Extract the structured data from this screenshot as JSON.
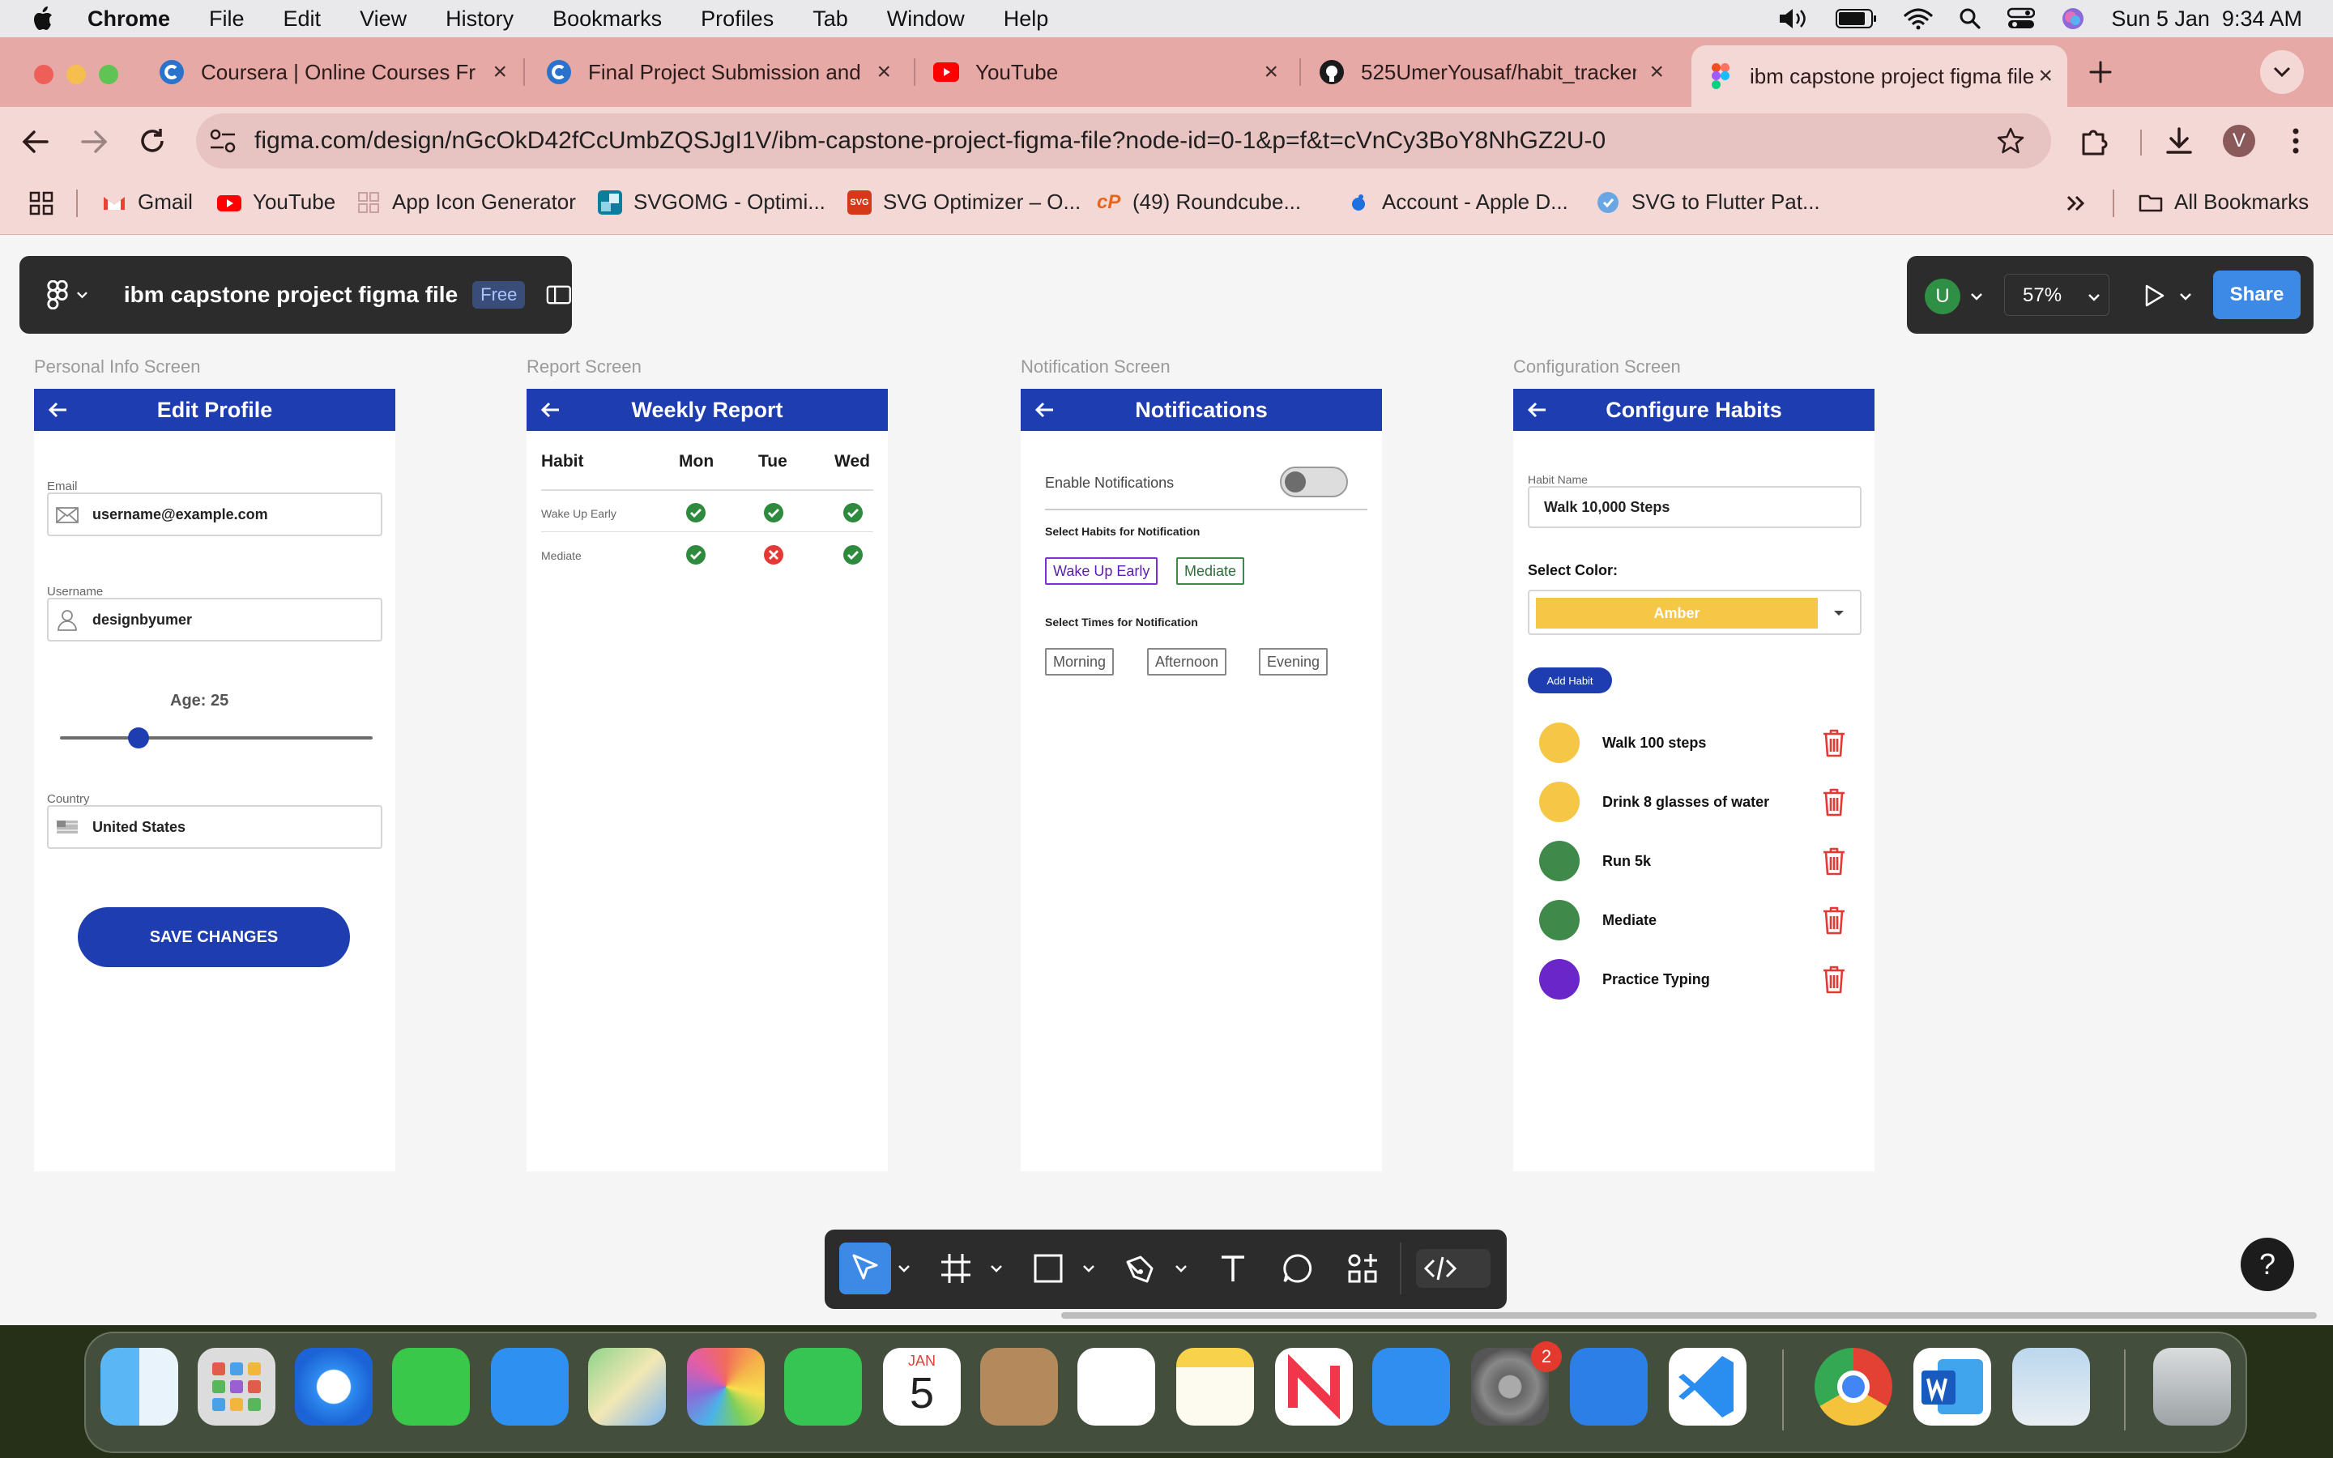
{
  "menubar": {
    "app": "Chrome",
    "items": [
      "File",
      "Edit",
      "View",
      "History",
      "Bookmarks",
      "Profiles",
      "Tab",
      "Window",
      "Help"
    ],
    "datetime": "Sun 5 Jan  9:34 AM"
  },
  "tabs": [
    {
      "title": "Coursera | Online Courses From",
      "icon": "coursera-icon"
    },
    {
      "title": "Final Project Submission and",
      "icon": "coursera-icon"
    },
    {
      "title": "YouTube",
      "icon": "youtube-icon"
    },
    {
      "title": "525UmerYousaf/habit_tracker",
      "icon": "github-icon"
    },
    {
      "title": "ibm capstone project figma file",
      "icon": "figma-icon"
    }
  ],
  "address": {
    "url": "figma.com/design/nGcOkD42fCcUmbZQSJgI1V/ibm-capstone-project-figma-file?node-id=0-1&p=f&t=cVnCy3BoY8NhGZ2U-0"
  },
  "profile": {
    "initial": "V"
  },
  "bookmarks": [
    "Gmail",
    "YouTube",
    "App Icon Generator",
    "SVGOMG - Optimi...",
    "SVG Optimizer – O...",
    "(49) Roundcube...",
    "Account - Apple D...",
    "SVG to Flutter Pat..."
  ],
  "bookmarks_all": "All Bookmarks",
  "figma": {
    "file_title": "ibm capstone project figma file",
    "plan_badge": "Free",
    "user_initial": "U",
    "zoom": "57%",
    "share": "Share"
  },
  "frames": {
    "personal": {
      "label": "Personal Info Screen",
      "title": "Edit Profile",
      "email_label": "Email",
      "email": "username@example.com",
      "username_label": "Username",
      "username": "designbyumer",
      "age_label": "Age: 25",
      "age_fraction": 0.25,
      "country_label": "Country",
      "country": "United States",
      "save": "SAVE CHANGES"
    },
    "report": {
      "label": "Report Screen",
      "title": "Weekly Report",
      "headers": [
        "Habit",
        "Mon",
        "Tue",
        "Wed"
      ],
      "rows": [
        {
          "habit": "Wake Up Early",
          "status": [
            "done",
            "done",
            "done"
          ]
        },
        {
          "habit": "Mediate",
          "status": [
            "done",
            "missed",
            "done"
          ]
        }
      ]
    },
    "notifications": {
      "label": "Notification Screen",
      "title": "Notifications",
      "enable_label": "Enable Notifications",
      "enabled": false,
      "habits_label": "Select Habits for Notification",
      "habits": [
        "Wake Up Early",
        "Mediate"
      ],
      "times_label": "Select Times for Notification",
      "times": [
        "Morning",
        "Afternoon",
        "Evening"
      ]
    },
    "config": {
      "label": "Configuration Screen",
      "title": "Configure Habits",
      "habit_name_label": "Habit Name",
      "habit_name": "Walk 10,000 Steps",
      "color_label": "Select Color:",
      "color_value": "Amber",
      "add_button": "Add Habit",
      "habits": [
        {
          "name": "Walk 100 steps",
          "color": "#f6c647"
        },
        {
          "name": "Drink 8 glasses of water",
          "color": "#f6c647"
        },
        {
          "name": "Run 5k",
          "color": "#3f8a4a"
        },
        {
          "name": "Mediate",
          "color": "#3f8a4a"
        },
        {
          "name": "Practice Typing",
          "color": "#6a26c9"
        }
      ]
    }
  },
  "help": "?",
  "dock": {
    "calendar_month": "JAN",
    "calendar_day": "5",
    "settings_badge": "2"
  },
  "colors": {
    "primary": "#1e3db0",
    "figma_blue": "#3d8ae6",
    "tab_bar": "#e7a9a6"
  }
}
